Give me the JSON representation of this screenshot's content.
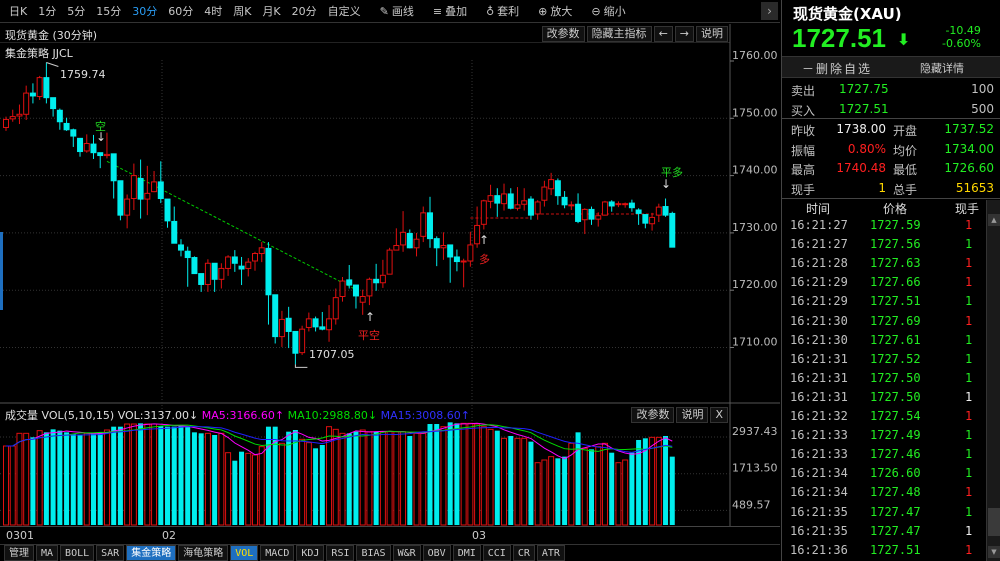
{
  "toolbar": {
    "periods": [
      "日K",
      "1分",
      "5分",
      "15分",
      "30分",
      "60分",
      "4时",
      "周K",
      "月K",
      "20分",
      "自定义"
    ],
    "active_period": "30分",
    "tools": [
      {
        "label": "画线",
        "icon": "pencil-icon",
        "glyph": "✎"
      },
      {
        "label": "叠加",
        "icon": "stack-icon",
        "glyph": "≡"
      },
      {
        "label": "套利",
        "icon": "money-bag-icon",
        "glyph": "♁"
      },
      {
        "label": "放大",
        "icon": "zoom-in-icon",
        "glyph": "⊕"
      },
      {
        "label": "缩小",
        "icon": "zoom-out-icon",
        "glyph": "⊖"
      }
    ],
    "next": "›"
  },
  "chart": {
    "title": "现货黄金 (30分钟)",
    "buttons": {
      "params": "改参数",
      "hide_main": "隐藏主指标",
      "left": "←",
      "right": "→",
      "help": "说明"
    },
    "strategy": "集金策略 JJCL",
    "high_label": "1759.74",
    "low_label": "1707.05",
    "signals": {
      "short": "空",
      "close_short": "平空",
      "long": "多",
      "close_long": "平多",
      "down_arrow": "↓",
      "up_arrow": "↑"
    }
  },
  "volume": {
    "title": "成交量",
    "params": "VOL(5,10,15)",
    "vol": "VOL:3137.00↓",
    "ma5": "MA5:3166.60↑",
    "ma10": "MA10:2988.80↓",
    "ma15": "MA15:3008.60↑",
    "buttons": {
      "params": "改参数",
      "help": "说明",
      "close": "X"
    }
  },
  "dates": [
    "0301",
    "02",
    "03"
  ],
  "tabs": [
    "管理",
    "MA",
    "BOLL",
    "SAR",
    "集金策略",
    "海龟策略",
    "VOL",
    "MACD",
    "KDJ",
    "RSI",
    "BIAS",
    "W&R",
    "OBV",
    "DMI",
    "CCI",
    "CR",
    "ATR"
  ],
  "colors": {
    "up": "#e01010",
    "down": "#00eeee",
    "ma5": "#ff00ff",
    "ma10": "#00dd00",
    "ma15": "#2020ff",
    "accent": "#1e6fc0"
  },
  "quote": {
    "name": "现货黄金(XAU)",
    "price": "1727.51",
    "change": "-10.49",
    "change_pct": "-0.60%",
    "delete_label": "－删除自选",
    "hide_label": "隐藏详情",
    "sell": {
      "label": "卖出",
      "price": "1727.75",
      "vol": "100"
    },
    "buy": {
      "label": "买入",
      "price": "1727.51",
      "vol": "500"
    },
    "stats": [
      {
        "l1": "昨收",
        "v1": "1738.00",
        "c1": "w",
        "l2": "开盘",
        "v2": "1737.52",
        "c2": "g"
      },
      {
        "l1": "振幅",
        "v1": "0.80%",
        "c1": "r",
        "l2": "均价",
        "v2": "1734.00",
        "c2": "g"
      },
      {
        "l1": "最高",
        "v1": "1740.48",
        "c1": "r",
        "l2": "最低",
        "v2": "1726.60",
        "c2": "g"
      },
      {
        "l1": "现手",
        "v1": "1",
        "c1": "y",
        "l2": "总手",
        "v2": "51653",
        "c2": "y"
      }
    ]
  },
  "ticks": {
    "headers": [
      "时间",
      "价格",
      "现手"
    ],
    "rows": [
      [
        "16:21:27",
        "1727.59",
        "1",
        "r"
      ],
      [
        "16:21:27",
        "1727.56",
        "1",
        "g"
      ],
      [
        "16:21:28",
        "1727.63",
        "1",
        "r"
      ],
      [
        "16:21:29",
        "1727.66",
        "1",
        "r"
      ],
      [
        "16:21:29",
        "1727.51",
        "1",
        "g"
      ],
      [
        "16:21:30",
        "1727.69",
        "1",
        "r"
      ],
      [
        "16:21:30",
        "1727.61",
        "1",
        "g"
      ],
      [
        "16:21:31",
        "1727.52",
        "1",
        "g"
      ],
      [
        "16:21:31",
        "1727.50",
        "1",
        "g"
      ],
      [
        "16:21:31",
        "1727.50",
        "1",
        "w"
      ],
      [
        "16:21:32",
        "1727.54",
        "1",
        "r"
      ],
      [
        "16:21:33",
        "1727.49",
        "1",
        "g"
      ],
      [
        "16:21:33",
        "1727.46",
        "1",
        "g"
      ],
      [
        "16:21:34",
        "1726.60",
        "1",
        "g"
      ],
      [
        "16:21:34",
        "1727.48",
        "1",
        "r"
      ],
      [
        "16:21:35",
        "1727.47",
        "1",
        "g"
      ],
      [
        "16:21:35",
        "1727.47",
        "1",
        "w"
      ],
      [
        "16:21:36",
        "1727.51",
        "1",
        "r"
      ]
    ]
  },
  "chart_data": {
    "type": "candlestick",
    "title": "现货黄金 (30分钟)",
    "price_ticks": [
      "1760.00",
      "1750.00",
      "1740.00",
      "1730.00",
      "1720.00",
      "1710.00"
    ],
    "price_tick_values": [
      1760,
      1750,
      1740,
      1730,
      1720,
      1710
    ],
    "vol_ticks": [
      "2937.43",
      "1713.50",
      "489.57"
    ],
    "vol_tick_values": [
      2937.43,
      1713.5,
      489.57
    ],
    "candles_ohlc": [
      [
        1748.4,
        1750.3,
        1747.8,
        1749.8
      ],
      [
        1749.9,
        1751.5,
        1749.4,
        1750.3
      ],
      [
        1750.4,
        1752.4,
        1749.0,
        1750.7
      ],
      [
        1750.7,
        1755.7,
        1749.7,
        1754.4
      ],
      [
        1754.4,
        1756.1,
        1752.6,
        1753.9
      ],
      [
        1753.8,
        1757.4,
        1753.2,
        1757.1
      ],
      [
        1757.1,
        1759.74,
        1752.6,
        1753.6
      ],
      [
        1753.6,
        1753.6,
        1750.3,
        1751.7
      ],
      [
        1751.4,
        1751.7,
        1748.0,
        1749.4
      ],
      [
        1749.1,
        1750.1,
        1747.8,
        1748.0
      ],
      [
        1748.0,
        1748.2,
        1745.0,
        1746.9
      ],
      [
        1746.5,
        1746.5,
        1743.3,
        1744.2
      ],
      [
        1744.3,
        1747.2,
        1744.0,
        1745.6
      ],
      [
        1745.5,
        1747.1,
        1742.9,
        1744.0
      ],
      [
        1744.0,
        1744.0,
        1741.3,
        1743.5
      ],
      [
        1743.5,
        1747.5,
        1743.0,
        1743.7
      ],
      [
        1743.8,
        1743.8,
        1736.0,
        1739.1
      ],
      [
        1739.1,
        1739.1,
        1732.2,
        1733.1
      ],
      [
        1733.1,
        1736.7,
        1730.8,
        1735.9
      ],
      [
        1736.0,
        1742.1,
        1734.0,
        1740.0
      ],
      [
        1739.5,
        1742.8,
        1732.5,
        1735.9
      ],
      [
        1735.9,
        1741.7,
        1733.1,
        1736.9
      ],
      [
        1737.2,
        1740.8,
        1737.1,
        1738.9
      ],
      [
        1738.9,
        1742.5,
        1735.2,
        1736.0
      ],
      [
        1735.9,
        1735.9,
        1730.9,
        1732.1
      ],
      [
        1732.0,
        1734.6,
        1728.2,
        1728.2
      ],
      [
        1727.9,
        1728.9,
        1725.9,
        1727.0
      ],
      [
        1726.8,
        1727.6,
        1720.6,
        1725.7
      ],
      [
        1725.7,
        1725.9,
        1722.9,
        1722.9
      ],
      [
        1722.9,
        1722.9,
        1719.7,
        1721.0
      ],
      [
        1721.0,
        1725.4,
        1719.7,
        1724.7
      ],
      [
        1724.7,
        1724.7,
        1719.7,
        1721.9
      ],
      [
        1721.9,
        1724.7,
        1720.3,
        1723.8
      ],
      [
        1723.8,
        1726.1,
        1722.5,
        1725.8
      ],
      [
        1725.8,
        1727.0,
        1723.2,
        1724.7
      ],
      [
        1724.2,
        1725.8,
        1720.9,
        1723.7
      ],
      [
        1723.8,
        1725.6,
        1722.4,
        1724.9
      ],
      [
        1725.1,
        1726.7,
        1723.4,
        1726.4
      ],
      [
        1726.4,
        1728.4,
        1724.9,
        1727.4
      ],
      [
        1727.3,
        1728.4,
        1714.0,
        1719.2
      ],
      [
        1719.2,
        1719.2,
        1710.7,
        1711.9
      ],
      [
        1711.9,
        1716.4,
        1710.1,
        1714.9
      ],
      [
        1715.1,
        1717.1,
        1709.9,
        1712.8
      ],
      [
        1712.8,
        1712.8,
        1707.05,
        1709.0
      ],
      [
        1709.1,
        1713.8,
        1708.7,
        1713.2
      ],
      [
        1713.5,
        1716.1,
        1712.8,
        1715.0
      ],
      [
        1715.0,
        1715.4,
        1712.8,
        1713.6
      ],
      [
        1713.6,
        1716.2,
        1713.0,
        1713.2
      ],
      [
        1713.1,
        1717.4,
        1711.0,
        1715.0
      ],
      [
        1715.0,
        1720.3,
        1714.0,
        1718.7
      ],
      [
        1718.9,
        1722.3,
        1718.0,
        1721.6
      ],
      [
        1721.8,
        1724.4,
        1720.3,
        1720.9
      ],
      [
        1720.9,
        1720.9,
        1716.8,
        1719.0
      ],
      [
        1717.9,
        1720.1,
        1715.7,
        1718.9
      ],
      [
        1719.0,
        1722.2,
        1717.4,
        1721.9
      ],
      [
        1721.9,
        1724.6,
        1719.9,
        1721.3
      ],
      [
        1721.3,
        1725.3,
        1720.4,
        1722.6
      ],
      [
        1722.8,
        1727.4,
        1722.8,
        1727.0
      ],
      [
        1727.0,
        1730.8,
        1727.0,
        1727.8
      ],
      [
        1727.9,
        1733.8,
        1726.7,
        1730.1
      ],
      [
        1729.9,
        1730.6,
        1727.3,
        1727.4
      ],
      [
        1727.4,
        1730.0,
        1725.9,
        1728.9
      ],
      [
        1729.4,
        1734.6,
        1728.4,
        1733.5
      ],
      [
        1733.5,
        1736.3,
        1727.4,
        1729.0
      ],
      [
        1729.0,
        1729.4,
        1724.2,
        1727.4
      ],
      [
        1727.4,
        1730.1,
        1725.3,
        1727.8
      ],
      [
        1727.9,
        1727.9,
        1721.3,
        1725.8
      ],
      [
        1725.8,
        1727.1,
        1723.3,
        1725.0
      ],
      [
        1725.0,
        1725.5,
        1720.5,
        1725.1
      ],
      [
        1725.1,
        1730.2,
        1724.1,
        1727.9
      ],
      [
        1728.1,
        1734.6,
        1727.4,
        1731.3
      ],
      [
        1731.5,
        1735.8,
        1730.6,
        1735.6
      ],
      [
        1735.5,
        1738.4,
        1734.3,
        1736.5
      ],
      [
        1736.5,
        1737.8,
        1732.8,
        1735.2
      ],
      [
        1735.1,
        1738.6,
        1733.9,
        1736.8
      ],
      [
        1736.8,
        1737.8,
        1734.1,
        1734.3
      ],
      [
        1734.3,
        1738.0,
        1733.9,
        1734.9
      ],
      [
        1735.0,
        1737.8,
        1733.9,
        1735.6
      ],
      [
        1735.9,
        1736.4,
        1732.3,
        1733.1
      ],
      [
        1733.3,
        1735.7,
        1732.3,
        1735.4
      ],
      [
        1735.7,
        1739.1,
        1734.6,
        1738.0
      ],
      [
        1737.7,
        1740.48,
        1736.6,
        1739.3
      ],
      [
        1739.1,
        1739.5,
        1734.9,
        1736.5
      ],
      [
        1736.2,
        1737.3,
        1734.3,
        1734.9
      ],
      [
        1734.8,
        1735.5,
        1734.0,
        1734.9
      ],
      [
        1735.0,
        1736.9,
        1731.7,
        1732.0
      ],
      [
        1732.3,
        1734.3,
        1729.8,
        1734.1
      ],
      [
        1734.1,
        1734.6,
        1731.4,
        1732.4
      ],
      [
        1732.4,
        1733.6,
        1731.1,
        1733.0
      ],
      [
        1733.1,
        1735.6,
        1733.0,
        1735.4
      ],
      [
        1735.4,
        1735.7,
        1733.7,
        1734.7
      ],
      [
        1735.0,
        1735.5,
        1734.5,
        1735.1
      ],
      [
        1735.0,
        1735.3,
        1734.4,
        1735.1
      ],
      [
        1735.2,
        1735.8,
        1733.7,
        1734.4
      ],
      [
        1734.0,
        1734.3,
        1731.4,
        1733.4
      ],
      [
        1733.2,
        1733.2,
        1730.8,
        1731.7
      ],
      [
        1731.6,
        1733.5,
        1730.4,
        1732.7
      ],
      [
        1733.1,
        1735.1,
        1731.9,
        1734.5
      ],
      [
        1734.6,
        1736.0,
        1732.8,
        1733.1
      ],
      [
        1733.4,
        1733.7,
        1727.5,
        1727.51
      ]
    ],
    "volumes": [
      2638,
      2638,
      3062,
      3062,
      2928,
      3151,
      3095,
      3195,
      3151,
      3095,
      3039,
      3006,
      3062,
      3062,
      3095,
      3173,
      3284,
      3284,
      3373,
      3373,
      3396,
      3373,
      3373,
      3306,
      3284,
      3284,
      3306,
      3284,
      3095,
      3062,
      3062,
      3006,
      3062,
      2415,
      2148,
      2449,
      2394,
      2338,
      2617,
      3284,
      3284,
      2728,
      3117,
      3173,
      2862,
      2750,
      2561,
      2672,
      3284,
      3195,
      3062,
      3062,
      3117,
      3173,
      3117,
      3117,
      3117,
      3117,
      3117,
      3117,
      2973,
      3062,
      3062,
      3373,
      3373,
      3284,
      3429,
      3396,
      3396,
      3396,
      3373,
      3284,
      3195,
      3151,
      2895,
      2973,
      2895,
      2895,
      2784,
      2081,
      2171,
      2283,
      2227,
      2283,
      2728,
      3095,
      2561,
      2527,
      2617,
      2728,
      2415,
      2081,
      2171,
      2415,
      2840,
      2895,
      2928,
      2928,
      2973,
      2283
    ],
    "ma_periods": [
      5,
      10,
      15
    ],
    "price_range": [
      1702,
      1762
    ],
    "short_trend": {
      "from_index": 15,
      "from_price": 1742.5,
      "to_index": 52,
      "to_price": 1720.1
    },
    "long_position": [
      {
        "from_index": 69,
        "to_index": 78,
        "price": 1732.6
      },
      {
        "from_index": 78,
        "to_index": 97,
        "price": 1733.3
      }
    ],
    "signal_indices": {
      "short": 14,
      "close_short": 53,
      "long": 69,
      "close_long": 97
    }
  }
}
